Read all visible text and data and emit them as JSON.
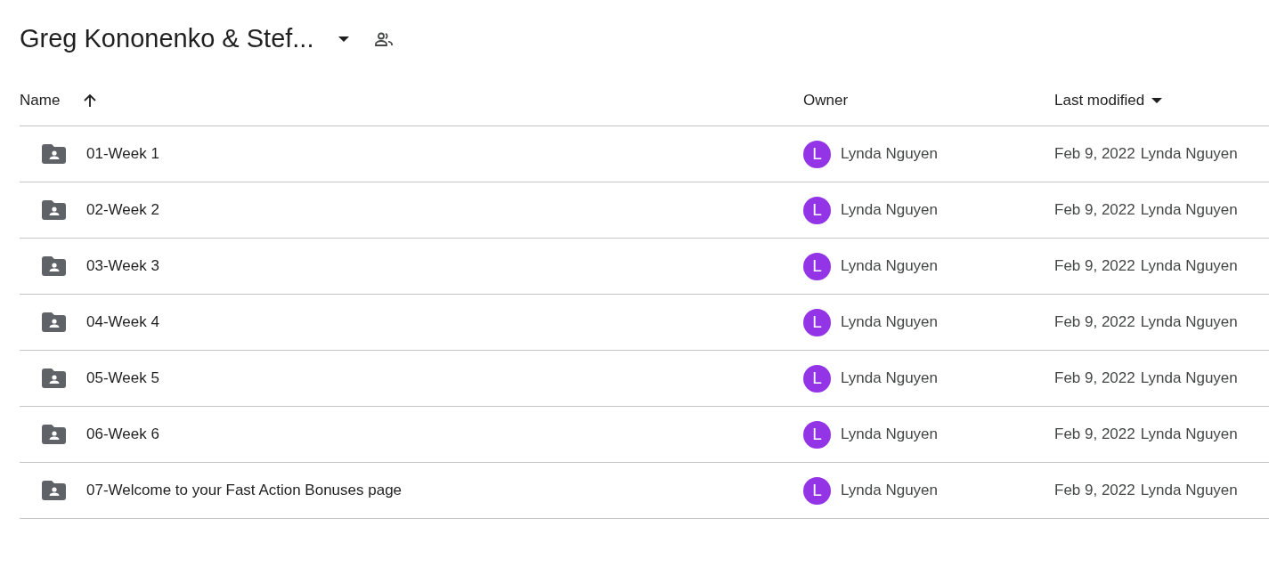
{
  "folder_title": "Greg Kononenko & Stef...",
  "table": {
    "columns": [
      {
        "label": "Name",
        "sorted": true,
        "ascending": true
      },
      {
        "label": "Owner",
        "sorted": false
      },
      {
        "label": "Last modified",
        "sorted": true,
        "ascending": false
      }
    ],
    "rows": [
      {
        "name": "01-Week 1",
        "owner_initial": "L",
        "owner": "Lynda Nguyen",
        "modified_date": "Feb 9, 2022",
        "modified_by": "Lynda Nguyen"
      },
      {
        "name": "02-Week 2",
        "owner_initial": "L",
        "owner": "Lynda Nguyen",
        "modified_date": "Feb 9, 2022",
        "modified_by": "Lynda Nguyen"
      },
      {
        "name": "03-Week 3",
        "owner_initial": "L",
        "owner": "Lynda Nguyen",
        "modified_date": "Feb 9, 2022",
        "modified_by": "Lynda Nguyen"
      },
      {
        "name": "04-Week 4",
        "owner_initial": "L",
        "owner": "Lynda Nguyen",
        "modified_date": "Feb 9, 2022",
        "modified_by": "Lynda Nguyen"
      },
      {
        "name": "05-Week 5",
        "owner_initial": "L",
        "owner": "Lynda Nguyen",
        "modified_date": "Feb 9, 2022",
        "modified_by": "Lynda Nguyen"
      },
      {
        "name": "06-Week 6",
        "owner_initial": "L",
        "owner": "Lynda Nguyen",
        "modified_date": "Feb 9, 2022",
        "modified_by": "Lynda Nguyen"
      },
      {
        "name": "07-Welcome to your Fast Action Bonuses page",
        "owner_initial": "L",
        "owner": "Lynda Nguyen",
        "modified_date": "Feb 9, 2022",
        "modified_by": "Lynda Nguyen"
      }
    ]
  }
}
